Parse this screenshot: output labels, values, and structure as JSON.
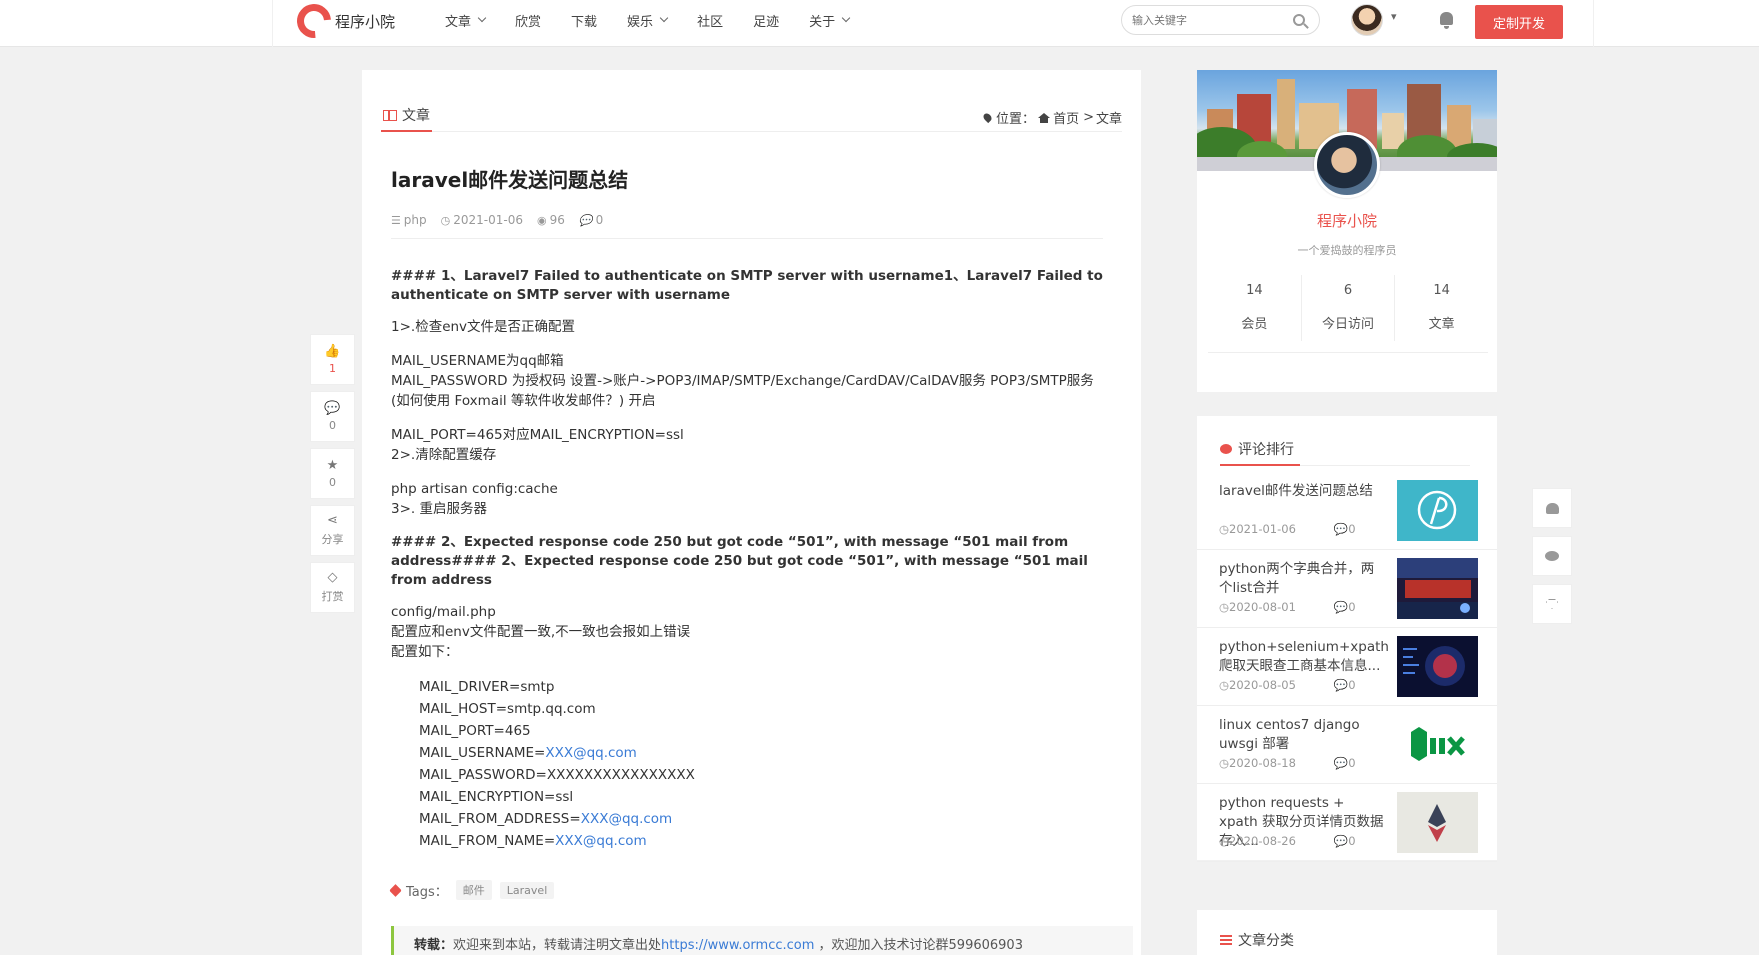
{
  "header": {
    "logo_text": "程序小院",
    "nav": [
      {
        "label": "文章",
        "has_dropdown": true
      },
      {
        "label": "欣赏",
        "has_dropdown": false
      },
      {
        "label": "下载",
        "has_dropdown": false
      },
      {
        "label": "娱乐",
        "has_dropdown": true
      },
      {
        "label": "社区",
        "has_dropdown": false
      },
      {
        "label": "足迹",
        "has_dropdown": false
      },
      {
        "label": "关于",
        "has_dropdown": true
      }
    ],
    "search_placeholder": "输入关键字",
    "user_menu_caret": "▾",
    "custom_btn": "定制开发",
    "accent": "#e9524c"
  },
  "float_left": {
    "like": {
      "count": "1"
    },
    "comment": {
      "count": "0"
    },
    "favorite": {
      "count": "0"
    },
    "share": {
      "label": "分享"
    },
    "reward": {
      "label": "打赏"
    }
  },
  "article": {
    "tab_label": "文章",
    "location_prefix": "位置：",
    "crumb_home": "首页",
    "crumb_sep": ">",
    "crumb_current": "文章",
    "title": "laravel邮件发送问题总结",
    "category": "php",
    "date": "2021-01-06",
    "views": "96",
    "comments": "0",
    "h1": "#### 1、Laravel7 Failed to authenticate on SMTP server with username1、Laravel7 Failed to authenticate on SMTP server with username",
    "p1": "1>.检查env文件是否正确配置",
    "p2_line1": "MAIL_USERNAME为qq邮箱",
    "p2_line2": "MAIL_PASSWORD 为授权码 设置->账户->POP3/IMAP/SMTP/Exchange/CardDAV/CalDAV服务 POP3/SMTP服务 (如何使用 Foxmail 等软件收发邮件？) 开启",
    "p3_line1": "MAIL_PORT=465对应MAIL_ENCRYPTION=ssl",
    "p3_line2": "2>.清除配置缓存",
    "p4_line1": "php artisan config:cache",
    "p4_line2": "3>. 重启服务器",
    "h2": "#### 2、Expected response code 250 but got code “501”, with message “501 mail from address#### 2、Expected response code 250 but got code “501”, with message “501 mail from address",
    "p5_line1": "config/mail.php",
    "p5_line2": "配置应和env文件配置一致,不一致也会报如上错误",
    "p5_line3": "配置如下：",
    "code": {
      "driver": "MAIL_DRIVER=smtp",
      "host": "MAIL_HOST=smtp.qq.com",
      "port": "MAIL_PORT=465",
      "username_key": "MAIL_USERNAME=",
      "username_val": "XXX@qq.com",
      "password": "MAIL_PASSWORD=XXXXXXXXXXXXXXXX",
      "encryption": "MAIL_ENCRYPTION=ssl",
      "from_address_key": "MAIL_FROM_ADDRESS=",
      "from_address_val": "XXX@qq.com",
      "from_name_key": "MAIL_FROM_NAME=",
      "from_name_val": "XXX@qq.com"
    },
    "tags_label": "Tags：",
    "tags": [
      "邮件",
      "Laravel"
    ],
    "copyright_bold": "转载：",
    "copyright_text": "欢迎来到本站，转载请注明文章出处",
    "copyright_link": "https://www.ormcc.com",
    "copyright_tail": " ，欢迎加入技术讨论群599606903"
  },
  "profile": {
    "name": "程序小院",
    "desc": "一个爱捣鼓的程序员",
    "stats": [
      {
        "value": "14",
        "label": "会员"
      },
      {
        "value": "6",
        "label": "今日访问"
      },
      {
        "value": "14",
        "label": "文章"
      }
    ]
  },
  "rank": {
    "title": "评论排行",
    "items": [
      {
        "title": "laravel邮件发送问题总结",
        "date": "2021-01-06",
        "comments": "0",
        "thumb": "laravel"
      },
      {
        "title": "python两个字典合并，两个list合并",
        "date": "2020-08-01",
        "comments": "0",
        "thumb": "python"
      },
      {
        "title": "python+selenium+xpath爬取天眼查工商基本信息...",
        "date": "2020-08-05",
        "comments": "0",
        "thumb": "brain"
      },
      {
        "title": "linux centos7 django uwsgi 部署",
        "date": "2020-08-18",
        "comments": "0",
        "thumb": "nginx"
      },
      {
        "title": "python requests + xpath 获取分页详情页数据存入...",
        "date": "2020-08-26",
        "comments": "0",
        "thumb": "eth"
      }
    ]
  },
  "category": {
    "title": "文章分类"
  }
}
